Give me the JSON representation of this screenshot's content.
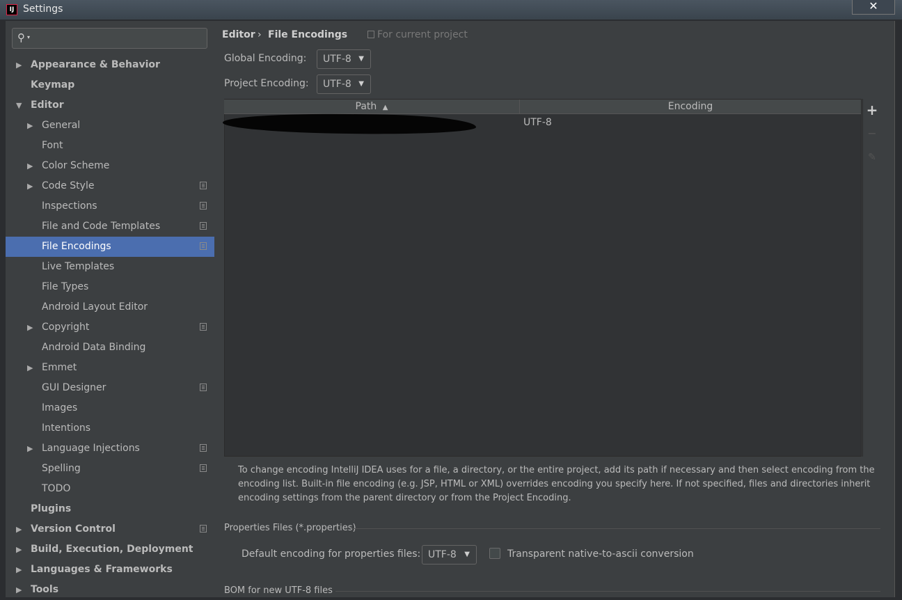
{
  "window": {
    "title": "Settings",
    "close_glyph": "✕",
    "app_icon_text": "IJ"
  },
  "search": {
    "icon": "search-icon",
    "caret": "▾",
    "value": ""
  },
  "sidebar": {
    "items": [
      {
        "label": "Appearance & Behavior",
        "level": 0,
        "bold": true,
        "expander": "collapsed",
        "project_icon": false
      },
      {
        "label": "Keymap",
        "level": 0,
        "bold": true,
        "expander": "none",
        "project_icon": false
      },
      {
        "label": "Editor",
        "level": 0,
        "bold": true,
        "expander": "expanded",
        "project_icon": false
      },
      {
        "label": "General",
        "level": 1,
        "bold": false,
        "expander": "collapsed",
        "project_icon": false
      },
      {
        "label": "Font",
        "level": 1,
        "bold": false,
        "expander": "none",
        "project_icon": false
      },
      {
        "label": "Color Scheme",
        "level": 1,
        "bold": false,
        "expander": "collapsed",
        "project_icon": false
      },
      {
        "label": "Code Style",
        "level": 1,
        "bold": false,
        "expander": "collapsed",
        "project_icon": true
      },
      {
        "label": "Inspections",
        "level": 1,
        "bold": false,
        "expander": "none",
        "project_icon": true
      },
      {
        "label": "File and Code Templates",
        "level": 1,
        "bold": false,
        "expander": "none",
        "project_icon": true
      },
      {
        "label": "File Encodings",
        "level": 1,
        "bold": false,
        "expander": "none",
        "project_icon": true,
        "selected": true
      },
      {
        "label": "Live Templates",
        "level": 1,
        "bold": false,
        "expander": "none",
        "project_icon": false
      },
      {
        "label": "File Types",
        "level": 1,
        "bold": false,
        "expander": "none",
        "project_icon": false
      },
      {
        "label": "Android Layout Editor",
        "level": 1,
        "bold": false,
        "expander": "none",
        "project_icon": false
      },
      {
        "label": "Copyright",
        "level": 1,
        "bold": false,
        "expander": "collapsed",
        "project_icon": true
      },
      {
        "label": "Android Data Binding",
        "level": 1,
        "bold": false,
        "expander": "none",
        "project_icon": false
      },
      {
        "label": "Emmet",
        "level": 1,
        "bold": false,
        "expander": "collapsed",
        "project_icon": false
      },
      {
        "label": "GUI Designer",
        "level": 1,
        "bold": false,
        "expander": "none",
        "project_icon": true
      },
      {
        "label": "Images",
        "level": 1,
        "bold": false,
        "expander": "none",
        "project_icon": false
      },
      {
        "label": "Intentions",
        "level": 1,
        "bold": false,
        "expander": "none",
        "project_icon": false
      },
      {
        "label": "Language Injections",
        "level": 1,
        "bold": false,
        "expander": "collapsed",
        "project_icon": true
      },
      {
        "label": "Spelling",
        "level": 1,
        "bold": false,
        "expander": "none",
        "project_icon": true
      },
      {
        "label": "TODO",
        "level": 1,
        "bold": false,
        "expander": "none",
        "project_icon": false
      },
      {
        "label": "Plugins",
        "level": 0,
        "bold": true,
        "expander": "none",
        "project_icon": false
      },
      {
        "label": "Version Control",
        "level": 0,
        "bold": true,
        "expander": "collapsed",
        "project_icon": true
      },
      {
        "label": "Build, Execution, Deployment",
        "level": 0,
        "bold": true,
        "expander": "collapsed",
        "project_icon": false
      },
      {
        "label": "Languages & Frameworks",
        "level": 0,
        "bold": true,
        "expander": "collapsed",
        "project_icon": false
      },
      {
        "label": "Tools",
        "level": 0,
        "bold": true,
        "expander": "collapsed",
        "project_icon": false
      }
    ]
  },
  "breadcrumb": {
    "parent": "Editor",
    "separator": "›",
    "current": "File Encodings"
  },
  "scope_note": "For current project",
  "global_encoding": {
    "label": "Global Encoding:",
    "value": "UTF-8"
  },
  "project_encoding": {
    "label": "Project Encoding:",
    "value": "UTF-8"
  },
  "table": {
    "columns": [
      "Path",
      "Encoding"
    ],
    "sort_indicator": "▲",
    "rows": [
      {
        "path": "",
        "encoding": "UTF-8"
      }
    ],
    "toolbar": {
      "add": "+",
      "remove": "−",
      "edit": "✎"
    }
  },
  "help_text": "To change encoding IntelliJ IDEA uses for a file, a directory, or the entire project, add its path if necessary and then select encoding from the encoding list. Built-in file encoding (e.g. JSP, HTML or XML) overrides encoding you specify here. If not specified, files and directories inherit encoding settings from the parent directory or from the Project Encoding.",
  "properties": {
    "section_title": "Properties Files (*.properties)",
    "default_label": "Default encoding for properties files:",
    "default_value": "UTF-8",
    "transparent_label": "Transparent native-to-ascii conversion",
    "transparent_checked": false
  },
  "bom": {
    "section_title": "BOM for new UTF-8 files"
  },
  "colors": {
    "selection": "#4b6eaf",
    "panel": "#3c3f41",
    "text": "#bbbbbb"
  }
}
